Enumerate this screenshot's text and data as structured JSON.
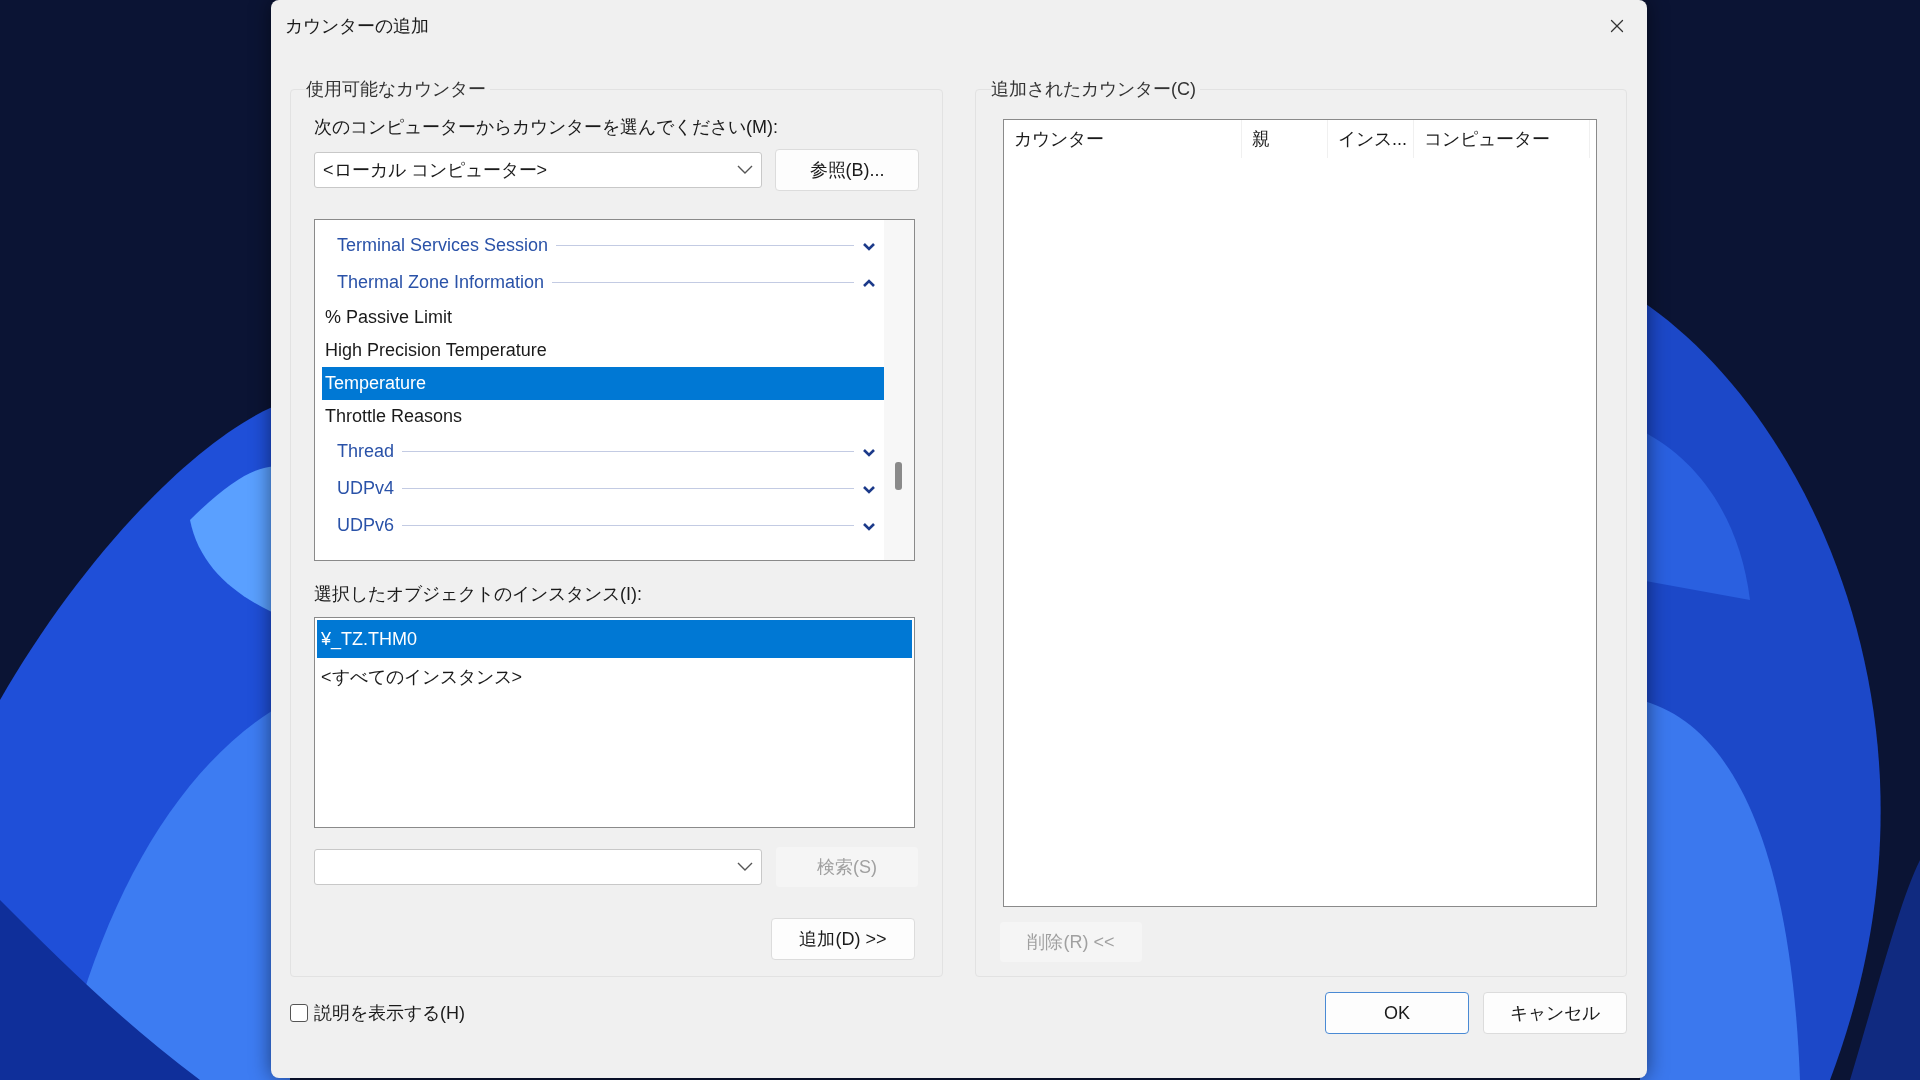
{
  "window": {
    "title": "カウンターの追加"
  },
  "available": {
    "legend": "使用可能なカウンター",
    "computer_label": "次のコンピューターからカウンターを選んでください(M):",
    "computer": "<ローカル コンピューター>",
    "browse": {
      "label": "参照(B)...",
      "disabled": false
    },
    "counters": [
      {
        "kind": "category",
        "label": "Terminal Services Session",
        "expanded": false
      },
      {
        "kind": "category",
        "label": "Thermal Zone Information",
        "expanded": true
      },
      {
        "kind": "counter",
        "label": "% Passive Limit",
        "selected": false
      },
      {
        "kind": "counter",
        "label": "High Precision Temperature",
        "selected": false
      },
      {
        "kind": "counter",
        "label": "Temperature",
        "selected": true
      },
      {
        "kind": "counter",
        "label": "Throttle Reasons",
        "selected": false
      },
      {
        "kind": "category",
        "label": "Thread",
        "expanded": false
      },
      {
        "kind": "category",
        "label": "UDPv4",
        "expanded": false
      },
      {
        "kind": "category",
        "label": "UDPv6",
        "expanded": false
      }
    ],
    "instances_label": "選択したオブジェクトのインスタンス(I):",
    "instances": [
      {
        "label": "¥_TZ.THM0",
        "selected": true
      },
      {
        "label": "<すべてのインスタンス>",
        "selected": false
      }
    ],
    "search": {
      "label": "検索(S)",
      "disabled": true
    },
    "add": {
      "label": "追加(D) >>",
      "disabled": false
    }
  },
  "added": {
    "legend": "追加されたカウンター(C)",
    "columns": [
      "カウンター",
      "親",
      "インス...",
      "コンピューター"
    ],
    "remove": {
      "label": "削除(R) <<",
      "disabled": true
    }
  },
  "show_description": {
    "label": "説明を表示する(H)",
    "checked": false
  },
  "buttons": [
    {
      "label": "OK",
      "default": true
    },
    {
      "label": "キャンセル",
      "default": false
    }
  ]
}
